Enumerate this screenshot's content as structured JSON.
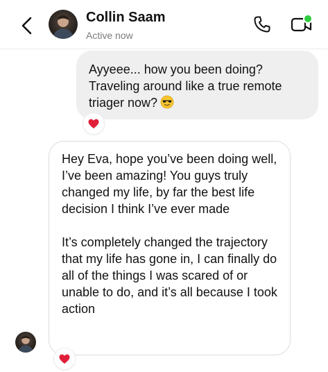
{
  "header": {
    "contact_name": "Collin Saam",
    "status": "Active now",
    "icons": [
      "back-arrow-icon",
      "phone-icon",
      "video-camera-icon"
    ],
    "online_indicator_color": "#2ecc40"
  },
  "messages": [
    {
      "direction": "outgoing",
      "text": "Ayyeee... how you been doing? Traveling around like a true remote triager now?",
      "emoji": "smiling-face-with-sunglasses",
      "reaction": "heart"
    },
    {
      "direction": "incoming",
      "paragraphs": [
        "Hey Eva, hope you’ve been doing well, I’ve been amazing! You guys truly changed my life, by far the best life decision I think I’ve ever made",
        "It’s completely changed the trajectory that my life has gone in, I can finally do all of the things I was scared of or unable to do, and it’s all because I took action"
      ],
      "reaction": "heart"
    }
  ],
  "colors": {
    "outgoing_bubble": "#efefef",
    "incoming_bubble_border": "#dcdcdc",
    "reaction_heart": "#e0203a"
  }
}
